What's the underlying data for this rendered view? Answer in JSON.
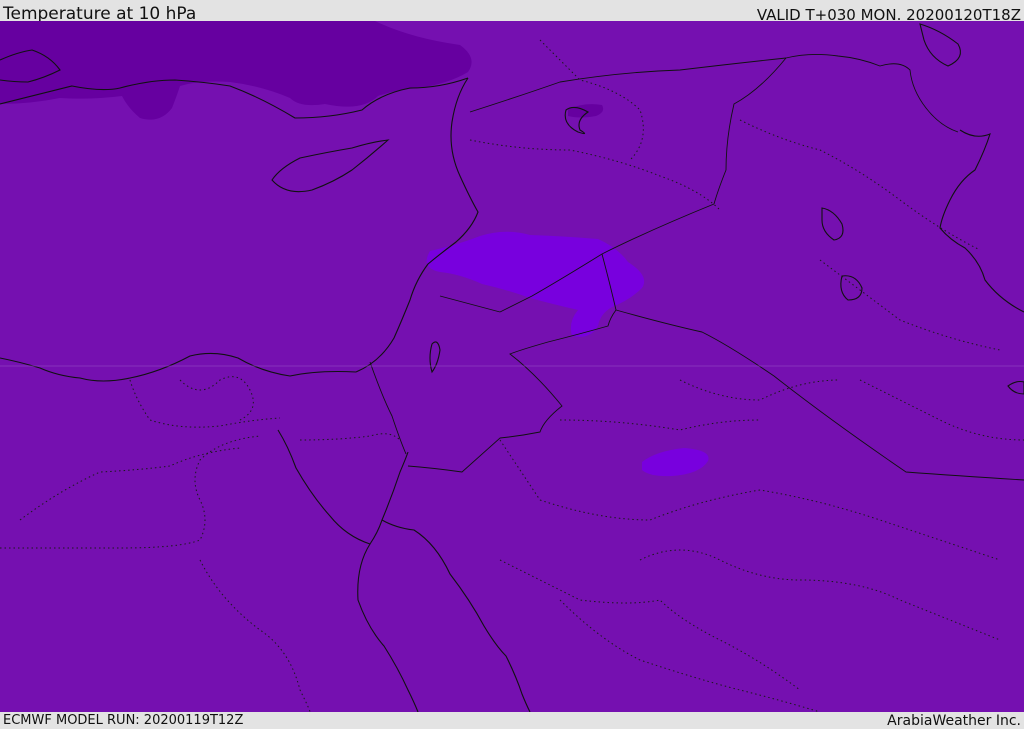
{
  "header": {
    "title": "Temperature at 10 hPa",
    "valid": "VALID T+030 MON. 20200120T18Z"
  },
  "footer": {
    "model_run": "ECMWF MODEL RUN: 20200119T12Z",
    "credit": "ArabiaWeather Inc."
  },
  "map": {
    "colors": {
      "base_field": "#7510b0",
      "cold_field": "#6600a0",
      "warm_field": "#7800de",
      "coastline": "#111111",
      "border": "#111111"
    }
  }
}
